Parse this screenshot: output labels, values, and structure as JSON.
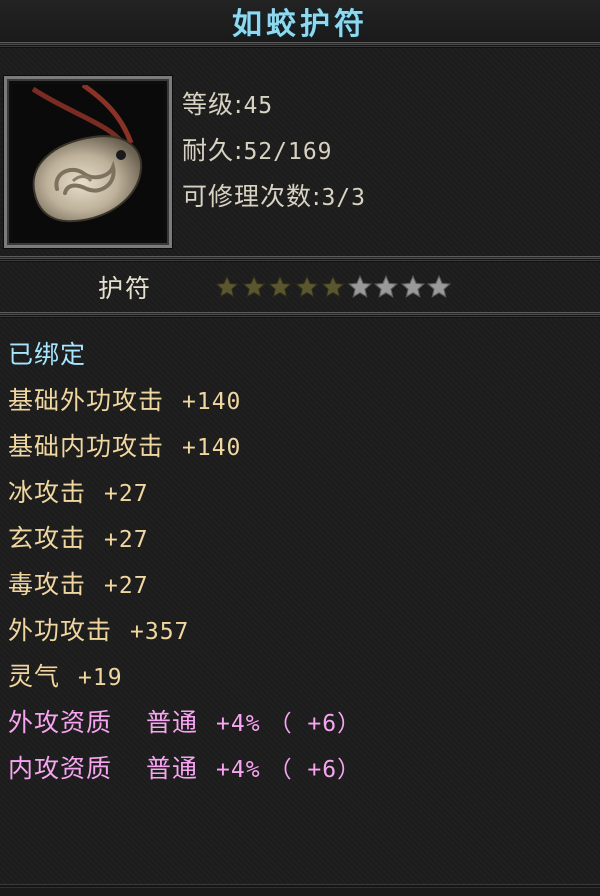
{
  "item": {
    "name": "如蛟护符",
    "icon": "jade-pendant-icon",
    "level_label": "等级:",
    "level_value": "45",
    "durability_label": "耐久:",
    "durability_value": "52/169",
    "repair_label": "可修理次数:",
    "repair_value": "3/3",
    "type": "护符",
    "stars_total": 9,
    "stars_filled": 5
  },
  "attributes": [
    {
      "label": "已绑定",
      "value": "",
      "color": "#a6e6ff"
    },
    {
      "label": "基础外功攻击",
      "value": "+140",
      "color": "#f0d7a0"
    },
    {
      "label": "基础内功攻击",
      "value": "+140",
      "color": "#f0d7a0"
    },
    {
      "label": "冰攻击",
      "value": "+27",
      "color": "#f0d7a0"
    },
    {
      "label": "玄攻击",
      "value": "+27",
      "color": "#f0d7a0"
    },
    {
      "label": "毒攻击",
      "value": "+27",
      "color": "#f0d7a0"
    },
    {
      "label": "外功攻击",
      "value": "+357",
      "color": "#f0d7a0"
    },
    {
      "label": "灵气",
      "value": "+19",
      "color": "#f0d7a0"
    },
    {
      "label": "外攻资质",
      "grade": "普通",
      "value": "+4%",
      "bonus": "（ +6）",
      "color": "#f7a5f1"
    },
    {
      "label": "内攻资质",
      "grade": "普通",
      "value": "+4%",
      "bonus": "（ +6）",
      "color": "#f7a5f1"
    }
  ],
  "colors": {
    "title": "#8fd8ee",
    "bound": "#a6e6ff",
    "stat": "#f0d7a0",
    "aptitude": "#f7a5f1",
    "star_filled": "#5a5630",
    "star_empty": "#9a9a9a"
  }
}
